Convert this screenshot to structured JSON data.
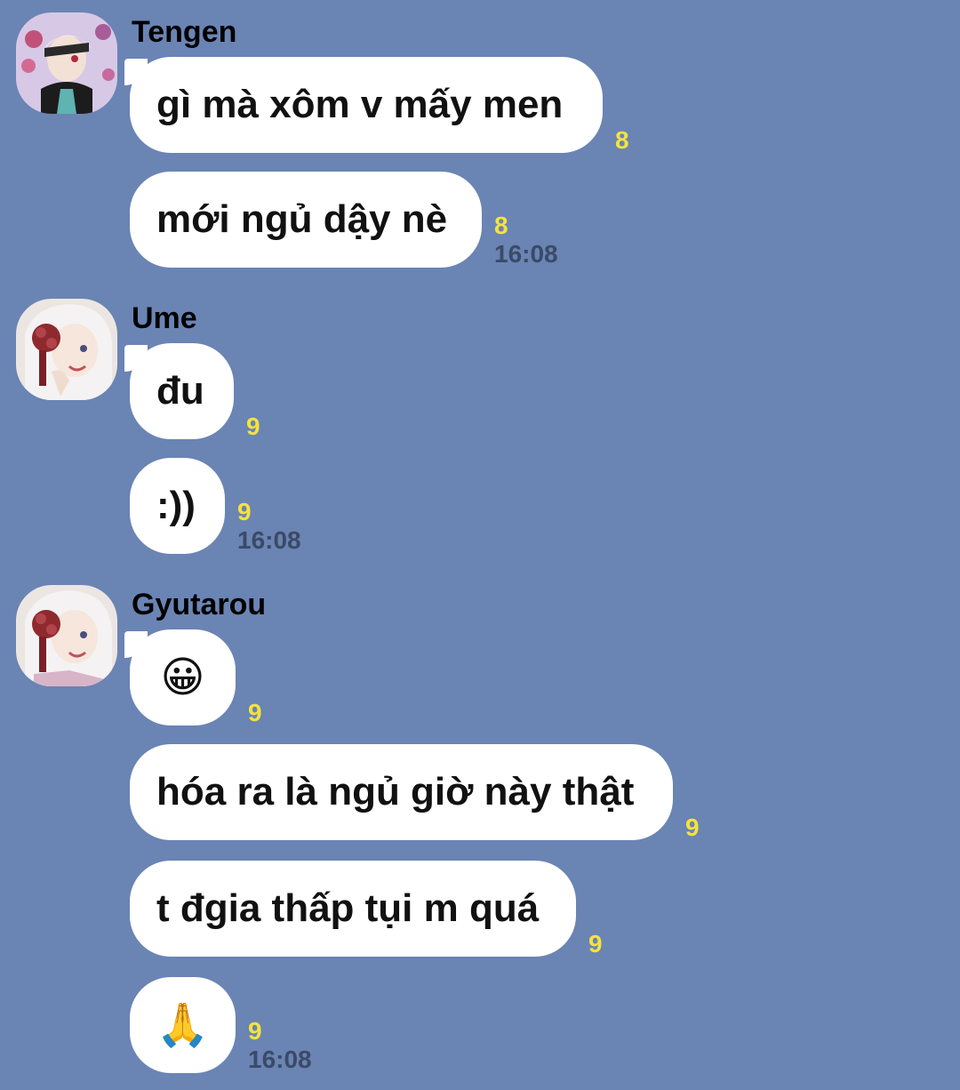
{
  "groups": [
    {
      "sender": "Tengen",
      "avatar_icon": "tengen-avatar",
      "messages": [
        {
          "text": "gì mà xôm v mấy men",
          "read": "8"
        },
        {
          "text": "mới ngủ dậy nè",
          "read": "8",
          "time": "16:08"
        }
      ]
    },
    {
      "sender": "Ume",
      "avatar_icon": "ume-avatar",
      "messages": [
        {
          "text": "đu",
          "read": "9"
        },
        {
          "text": ":))",
          "read": "9",
          "time": "16:08"
        }
      ]
    },
    {
      "sender": "Gyutarou",
      "avatar_icon": "gyutarou-avatar",
      "messages": [
        {
          "text": "😀",
          "read": "9"
        },
        {
          "text": "hóa ra là ngủ giờ này thật",
          "read": "9"
        },
        {
          "text": "t đgia thấp tụi m quá",
          "read": "9"
        },
        {
          "text": "🙏",
          "read": "9",
          "time": "16:08"
        }
      ]
    }
  ],
  "colors": {
    "background": "#6a84b4",
    "bubble": "#ffffff",
    "read_count": "#f4e33c",
    "timestamp": "#3b4a66"
  }
}
